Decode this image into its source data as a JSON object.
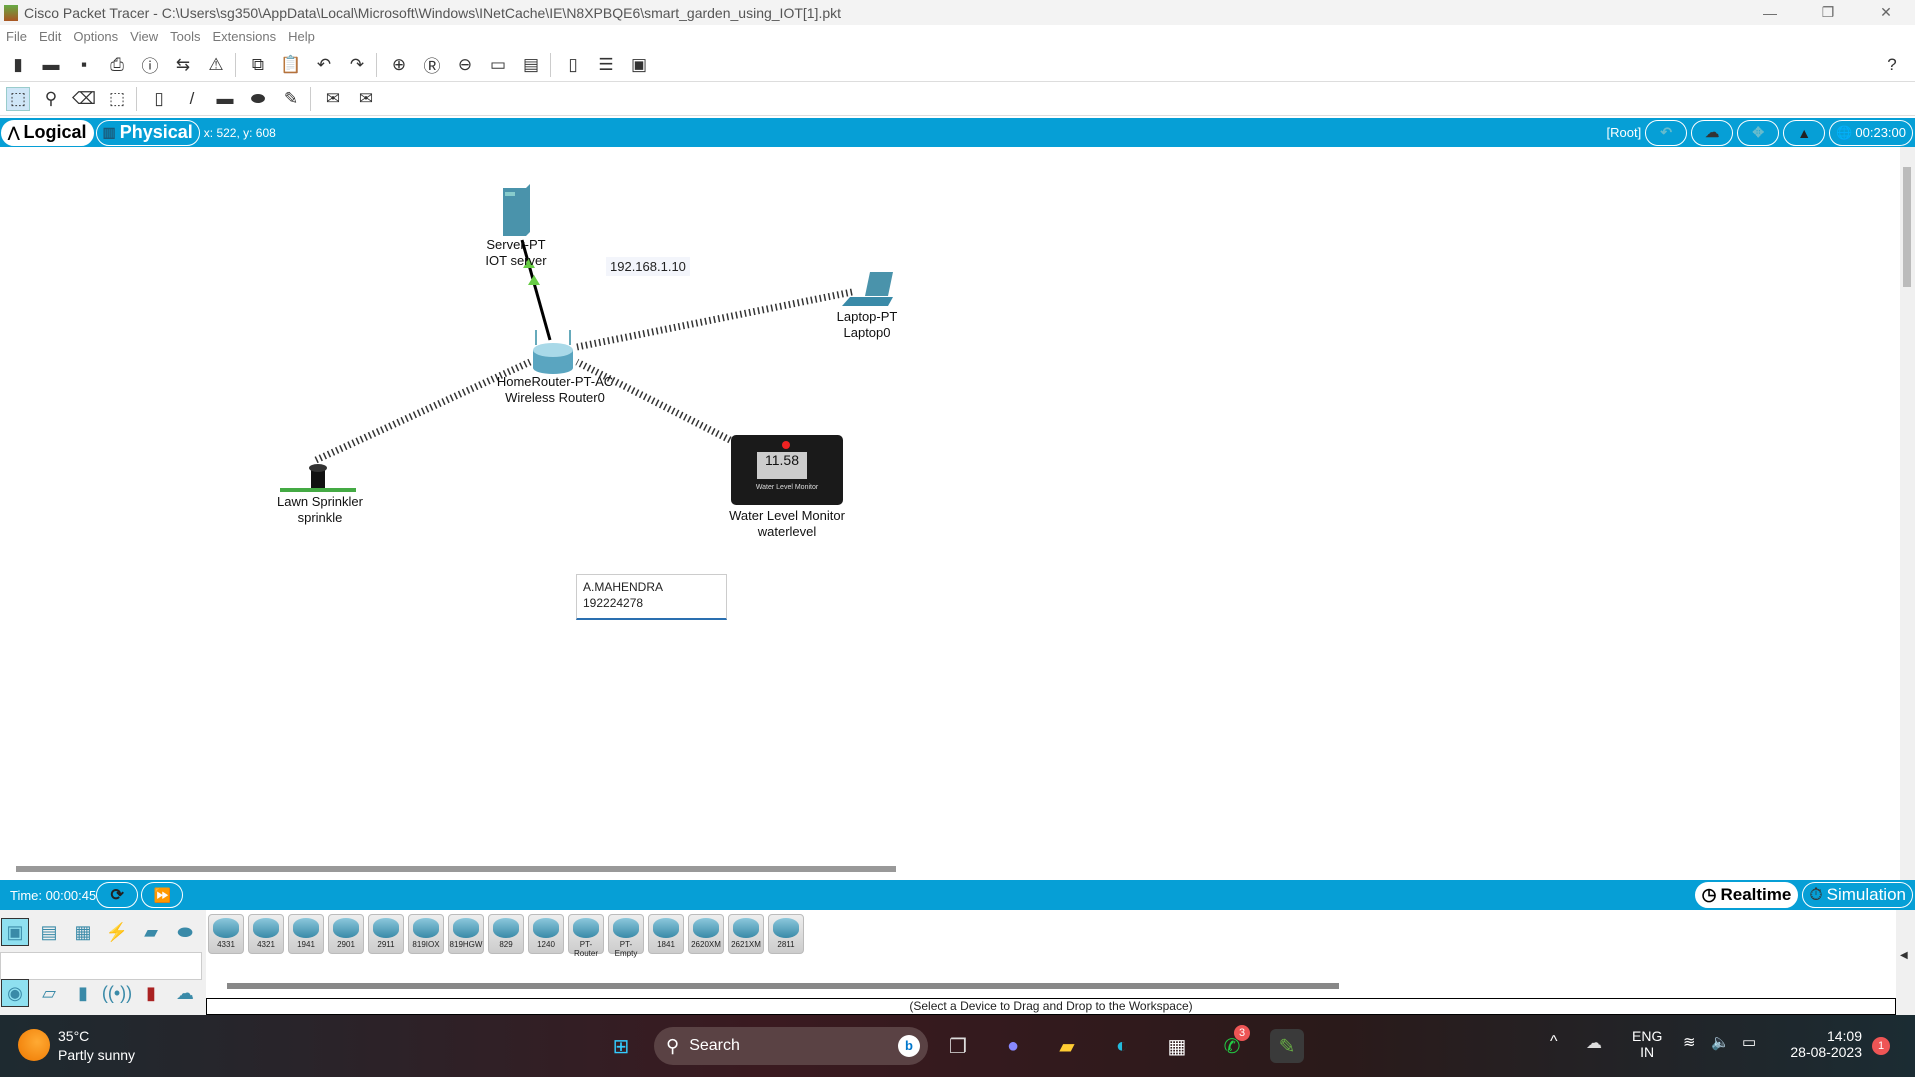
{
  "window": {
    "title": "Cisco Packet Tracer - C:\\Users\\sg350\\AppData\\Local\\Microsoft\\Windows\\INetCache\\IE\\N8XPBQE6\\smart_garden_using_IOT[1].pkt",
    "minimize": "—",
    "restore": "❐",
    "close": "✕"
  },
  "menu": [
    "File",
    "Edit",
    "Options",
    "View",
    "Tools",
    "Extensions",
    "Help"
  ],
  "toolbar": {
    "help": "?"
  },
  "modebar": {
    "logical": "Logical",
    "physical": "Physical",
    "coords": "x: 522, y: 608",
    "root": "[Root]",
    "clock": "00:23:00"
  },
  "canvas": {
    "ip_label": "192.168.1.10",
    "devices": [
      {
        "type": "Server-PT",
        "name": "IOT server"
      },
      {
        "type": "Laptop-PT",
        "name": "Laptop0"
      },
      {
        "type": "HomeRouter-PT-AC",
        "name": "Wireless Router0"
      },
      {
        "type": "Lawn Sprinkler",
        "name": "sprinkle"
      },
      {
        "type": "Water Level Monitor",
        "name": "waterlevel",
        "reading": "11.58",
        "panel_text": "Water Level Monitor"
      }
    ],
    "note": {
      "line1": "A.MAHENDRA",
      "line2": "192224278"
    }
  },
  "timebar": {
    "time": "Time: 00:00:45",
    "realtime": "Realtime",
    "simulation": "Simulation"
  },
  "devices_panel": {
    "models": [
      "4331",
      "4321",
      "1941",
      "2901",
      "2911",
      "819IOX",
      "819HGW",
      "829",
      "1240",
      "PT-Router",
      "PT-Empty",
      "1841",
      "2620XM",
      "2621XM",
      "2811"
    ],
    "status": "(Select a Device to Drag and Drop to the Workspace)"
  },
  "taskbar": {
    "temp": "35°C",
    "weather": "Partly sunny",
    "search": "Search",
    "whatsapp_badge": "3",
    "lang1": "ENG",
    "lang2": "IN",
    "time": "14:09",
    "date": "28-08-2023",
    "notif": "1"
  },
  "colors": {
    "accent": "#069fd6"
  }
}
